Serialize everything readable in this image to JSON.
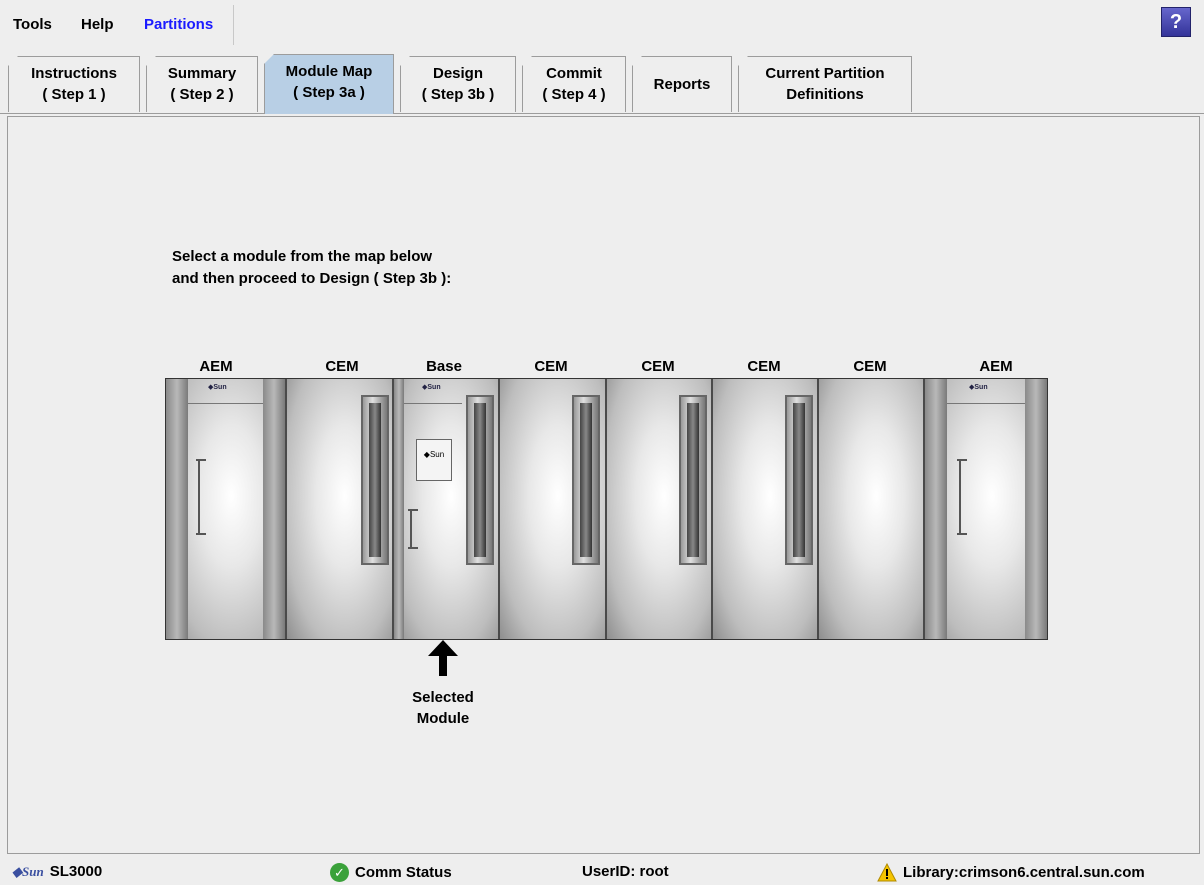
{
  "menubar": {
    "items": [
      "Tools",
      "Help",
      "Partitions"
    ],
    "active": "Partitions",
    "help_label": "?"
  },
  "tabs": [
    {
      "line1": "Instructions",
      "line2": "( Step 1 )"
    },
    {
      "line1": "Summary",
      "line2": "( Step 2 )"
    },
    {
      "line1": "Module Map",
      "line2": "( Step 3a )",
      "selected": true
    },
    {
      "line1": "Design",
      "line2": "( Step 3b )"
    },
    {
      "line1": "Commit",
      "line2": "( Step 4 )"
    },
    {
      "line1": "Reports",
      "line2": ""
    },
    {
      "line1": "Current Partition",
      "line2": "Definitions"
    }
  ],
  "content": {
    "instruction_line1": "Select a module from the map below",
    "instruction_line2": "and then proceed to Design ( Step 3b ):",
    "modules": [
      "AEM",
      "CEM",
      "Base",
      "CEM",
      "CEM",
      "CEM",
      "CEM",
      "AEM"
    ],
    "selected_module": "Base",
    "selected_line1": "Selected",
    "selected_line2": "Module"
  },
  "statusbar": {
    "product": "SL3000",
    "comm_status": "Comm Status",
    "user": "UserID: root",
    "library": "Library:crimson6.central.sun.com"
  },
  "colors": {
    "selected_tab": "#b8cfe5",
    "active_menu": "#1a1aff",
    "ok_green": "#3aa13a",
    "warn_yellow": "#f5c400"
  }
}
